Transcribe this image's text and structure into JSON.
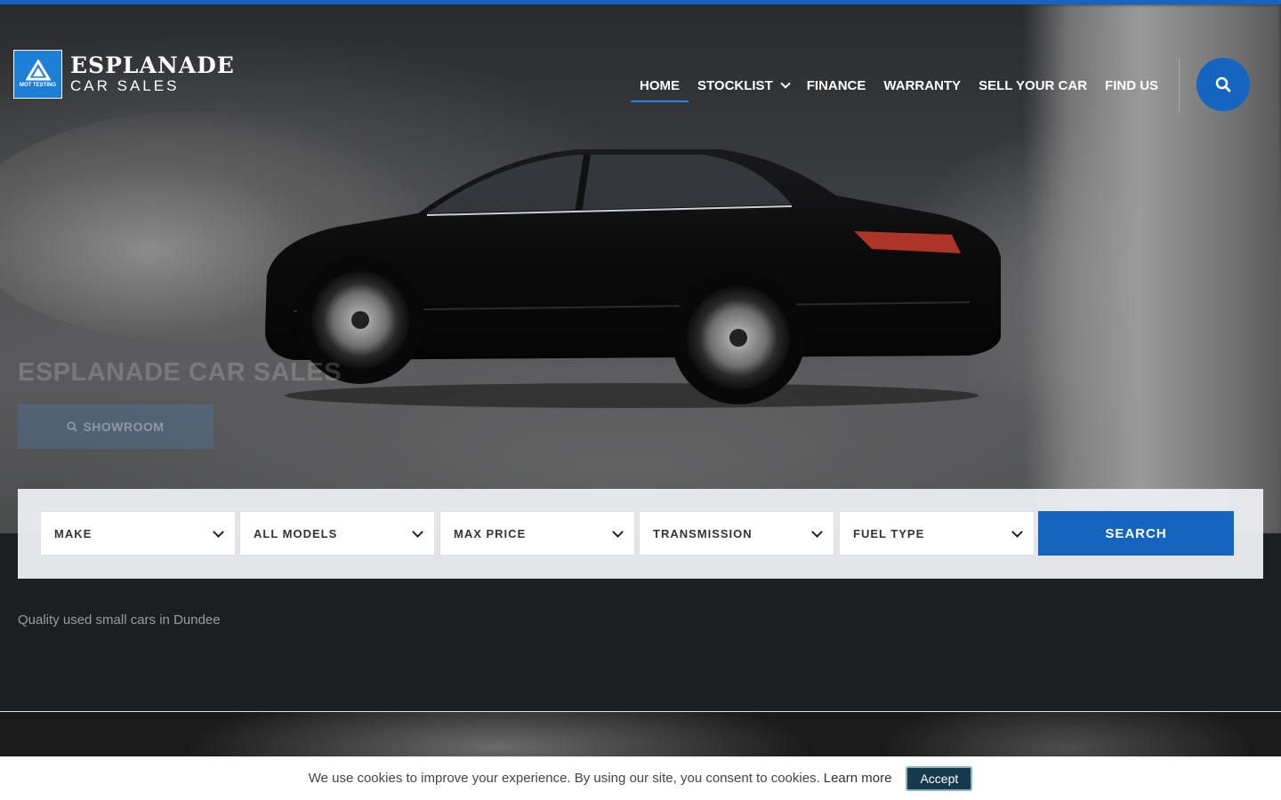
{
  "brand": {
    "title": "ESPLANADE",
    "subtitle": "CAR SALES",
    "badge_text": "MOT TESTING"
  },
  "nav": {
    "items": [
      {
        "label": "HOME",
        "active": true
      },
      {
        "label": "STOCKLIST",
        "dropdown": true
      },
      {
        "label": "FINANCE"
      },
      {
        "label": "WARRANTY"
      },
      {
        "label": "SELL YOUR CAR"
      },
      {
        "label": "FIND US"
      }
    ],
    "search_icon": "search-icon"
  },
  "hero": {
    "title": "ESPLANADE CAR SALES",
    "showroom_label": "SHOWROOM",
    "showroom_icon": "search-icon"
  },
  "search": {
    "make": "MAKE",
    "model": "ALL MODELS",
    "max_price": "MAX PRICE",
    "transmission": "TRANSMISSION",
    "fuel_type": "FUEL TYPE",
    "button": "SEARCH"
  },
  "tagline": "Quality used small cars in Dundee",
  "cookie": {
    "text": "We use cookies to improve your experience. By using our site, you consent to cookies.",
    "link": "Learn more",
    "accept": "Accept"
  },
  "colors": {
    "accent": "#1565c0",
    "panel": "#ebecf0",
    "accept_bg": "#163a4d"
  }
}
